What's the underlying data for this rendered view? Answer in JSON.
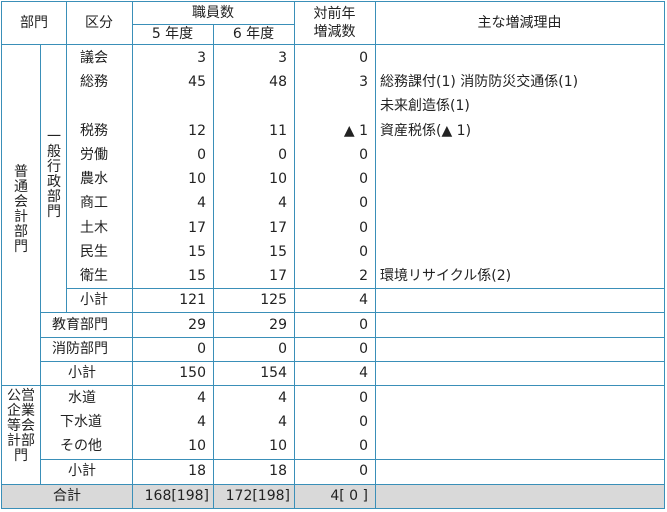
{
  "header": {
    "dept": "部門",
    "kubun": "区分",
    "staff": "職員数",
    "fy5": "5 年度",
    "fy6": "6 年度",
    "yoy1": "対前年",
    "yoy2": "増減数",
    "reason": "主な増減理由"
  },
  "groups": {
    "general_account": "普通会計部門",
    "general_admin": "一般行政部門",
    "public_enterprise": "公営企業等会計部門"
  },
  "rows": [
    {
      "name": "議会",
      "fy5": "3",
      "fy6": "3",
      "diff": "0",
      "reason": ""
    },
    {
      "name": "総務",
      "fy5": "45",
      "fy6": "48",
      "diff": "3",
      "reason": "総務課付(1)  消防防災交通係(1)"
    },
    {
      "name": "",
      "fy5": "",
      "fy6": "",
      "diff": "",
      "reason": "未来創造係(1)"
    },
    {
      "name": "税務",
      "fy5": "12",
      "fy6": "11",
      "diff": "▲ 1",
      "reason": "資産税係(▲ 1)"
    },
    {
      "name": "労働",
      "fy5": "0",
      "fy6": "0",
      "diff": "0",
      "reason": ""
    },
    {
      "name": "農水",
      "fy5": "10",
      "fy6": "10",
      "diff": "0",
      "reason": ""
    },
    {
      "name": "商工",
      "fy5": "4",
      "fy6": "4",
      "diff": "0",
      "reason": ""
    },
    {
      "name": "土木",
      "fy5": "17",
      "fy6": "17",
      "diff": "0",
      "reason": ""
    },
    {
      "name": "民生",
      "fy5": "15",
      "fy6": "15",
      "diff": "0",
      "reason": ""
    },
    {
      "name": "衛生",
      "fy5": "15",
      "fy6": "17",
      "diff": "2",
      "reason": "環境リサイクル係(2)"
    }
  ],
  "admin_subtotal": {
    "name": "小計",
    "fy5": "121",
    "fy6": "125",
    "diff": "4"
  },
  "education": {
    "name": "教育部門",
    "fy5": "29",
    "fy6": "29",
    "diff": "0"
  },
  "fire": {
    "name": "消防部門",
    "fy5": "0",
    "fy6": "0",
    "diff": "0"
  },
  "general_subtotal": {
    "name": "小計",
    "fy5": "150",
    "fy6": "154",
    "diff": "4"
  },
  "enterprise_rows": [
    {
      "name": "水道",
      "fy5": "4",
      "fy6": "4",
      "diff": "0"
    },
    {
      "name": "下水道",
      "fy5": "4",
      "fy6": "4",
      "diff": "0"
    },
    {
      "name": "その他",
      "fy5": "10",
      "fy6": "10",
      "diff": "0"
    }
  ],
  "enterprise_subtotal": {
    "name": "小計",
    "fy5": "18",
    "fy6": "18",
    "diff": "0"
  },
  "total": {
    "name": "合計",
    "fy5": "168[198]",
    "fy6": "172[198]",
    "diff": "4[ 0 ]"
  },
  "colors": {
    "border": "#3a8fb8",
    "total_bg": "#d9d9d9"
  }
}
